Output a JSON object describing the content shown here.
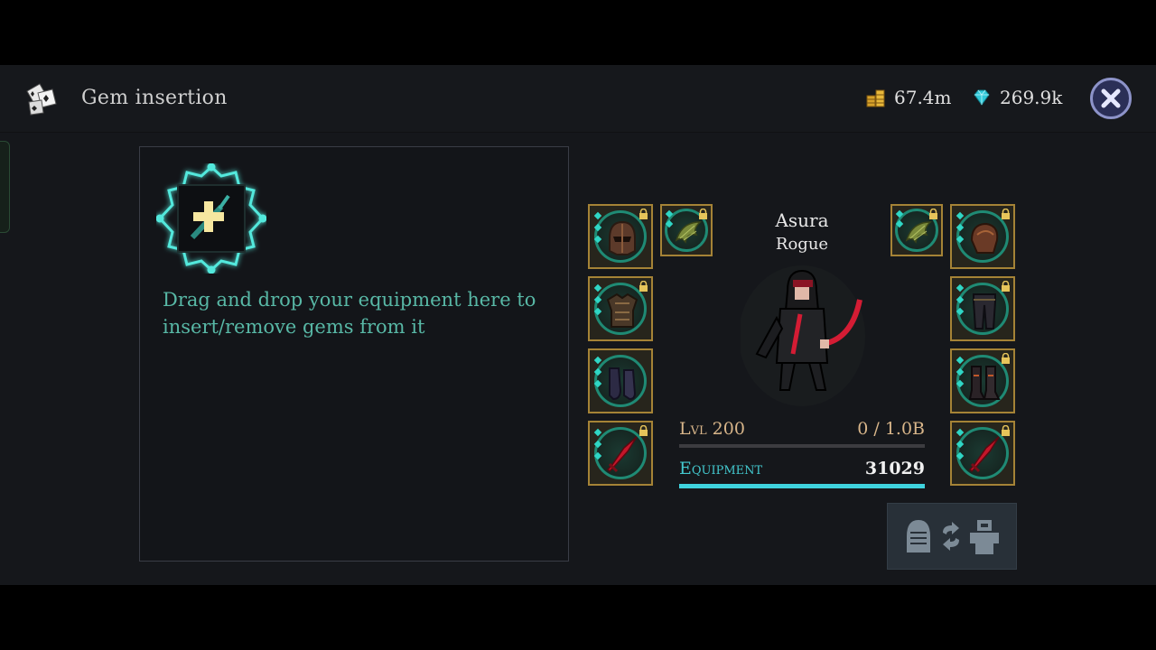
{
  "header": {
    "title": "Gem insertion",
    "gold_amount": "67.4m",
    "gem_amount": "269.9k"
  },
  "panel": {
    "hint": "Drag and drop your equipment here to insert/remove gems from it"
  },
  "character": {
    "name": "Asura",
    "class": "Rogue",
    "level_label": "Lvl 200",
    "xp_label": "0 / 1.0B",
    "xp_fraction": 0,
    "equipment_label": "Equipment",
    "equipment_value": "31029",
    "equipment_fraction": 1.0
  },
  "slots": {
    "left": [
      "helmet",
      "chest-armor",
      "gloves",
      "weapon"
    ],
    "left_extra": "wings",
    "right": [
      "shoulder-armor",
      "leggings",
      "boots",
      "weapon"
    ],
    "right_extra": "wings"
  },
  "colors": {
    "accent_teal": "#3fd3de",
    "gold_border": "#a58336",
    "hint_text": "#58b8a6"
  }
}
